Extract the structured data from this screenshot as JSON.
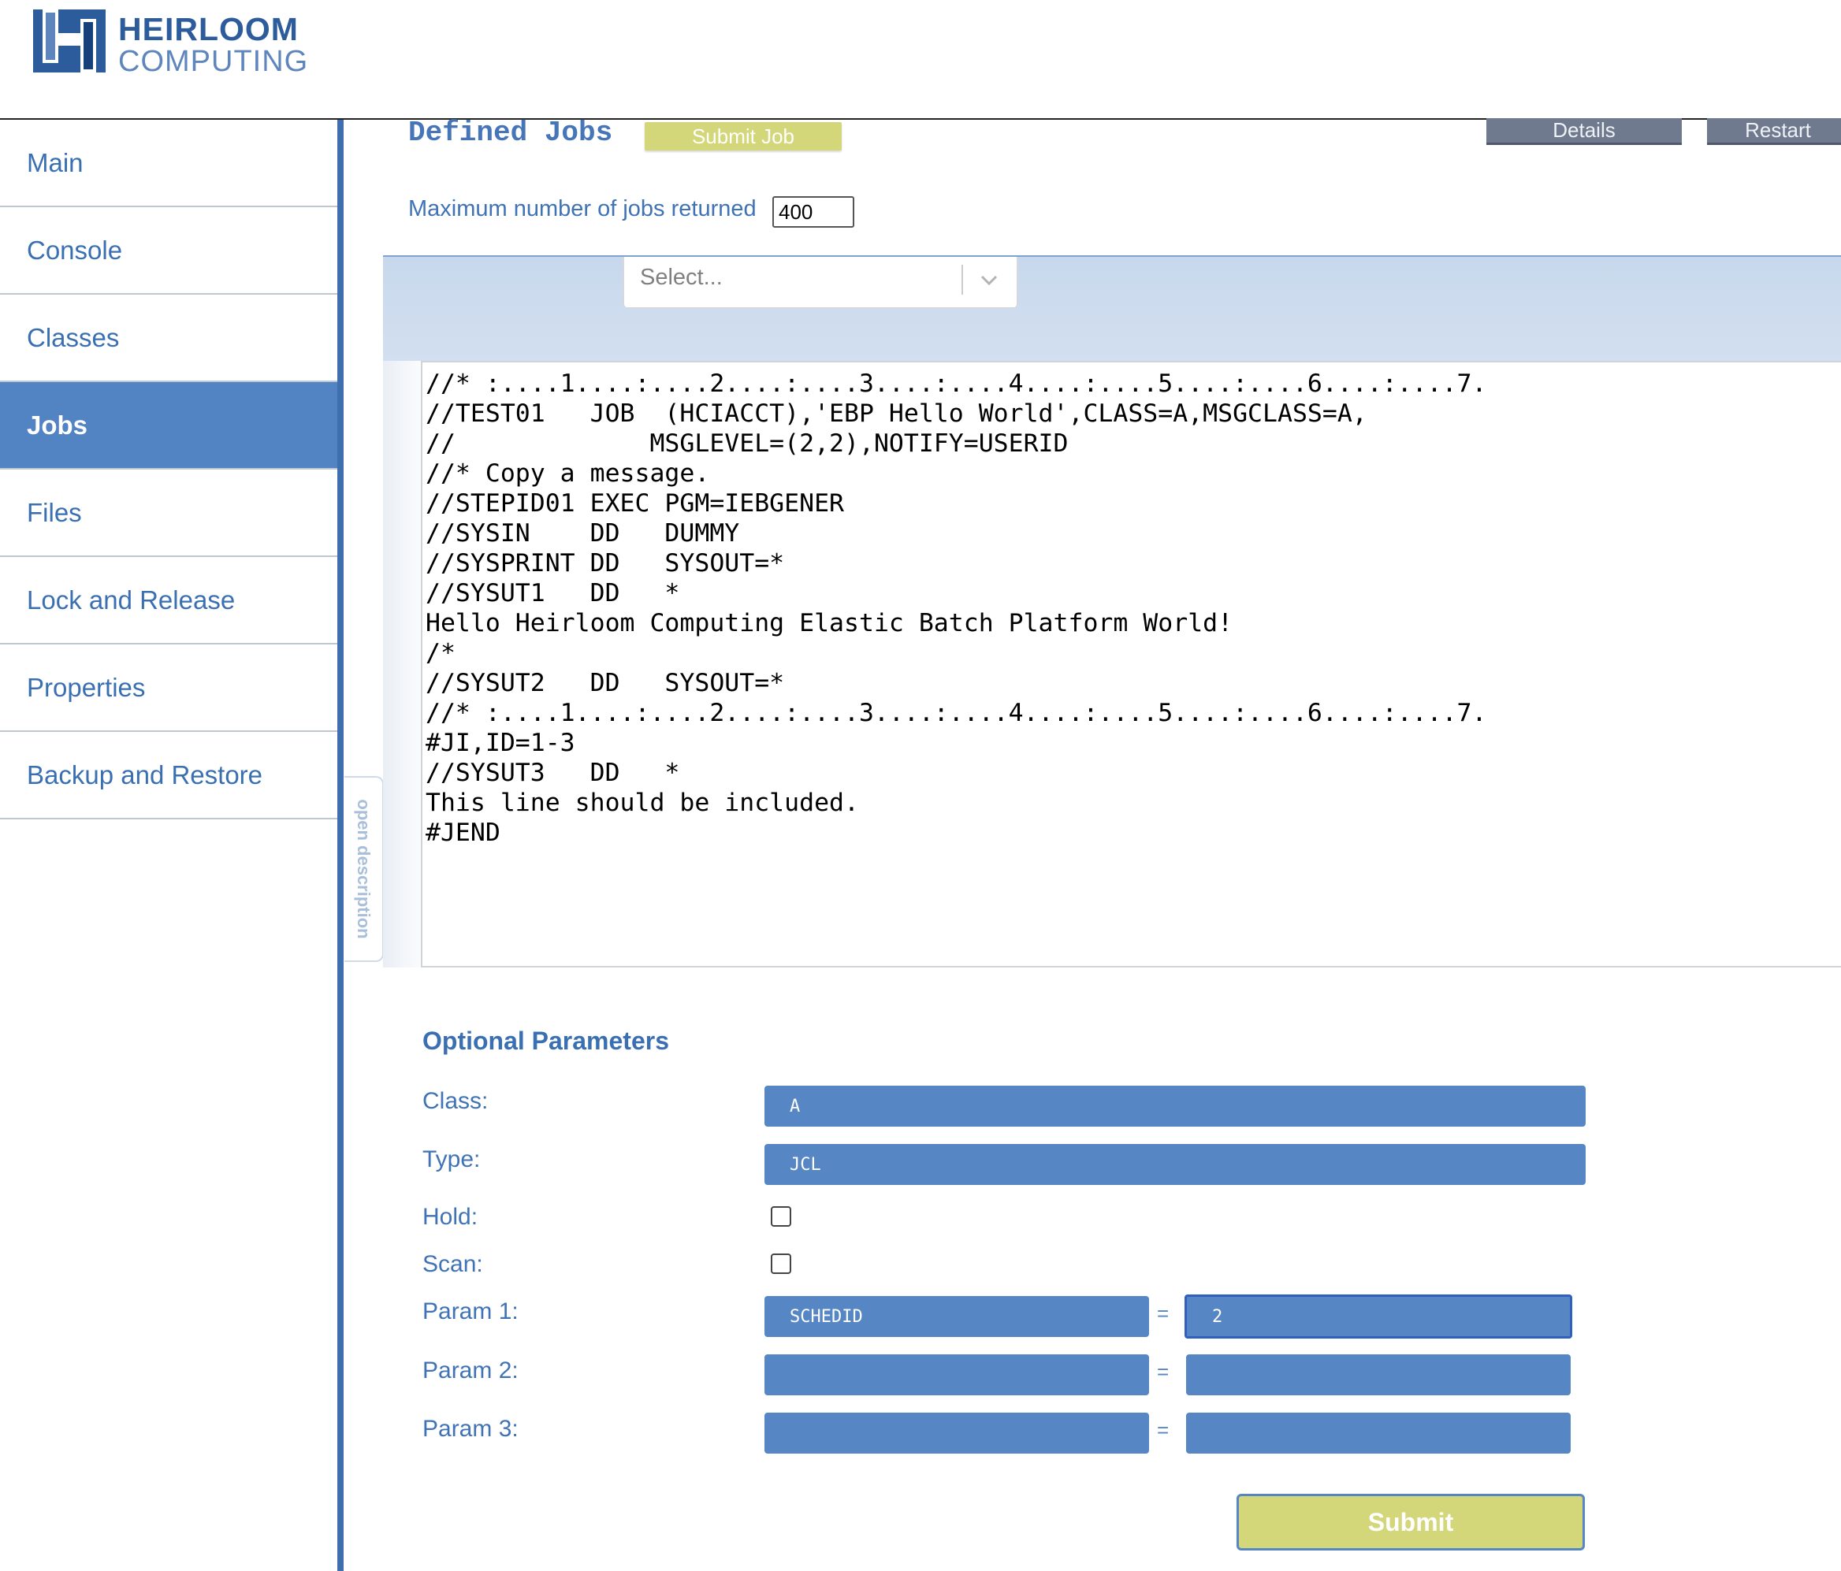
{
  "brand": {
    "line1": "HEIRLOOM",
    "line2": "COMPUTING",
    "colors": {
      "primary": "#2d5c9c",
      "secondary": "#5e86bd"
    }
  },
  "sidebar": {
    "items": [
      {
        "label": "Main"
      },
      {
        "label": "Console"
      },
      {
        "label": "Classes"
      },
      {
        "label": "Jobs",
        "active": true
      },
      {
        "label": "Files"
      },
      {
        "label": "Lock and Release"
      },
      {
        "label": "Properties"
      },
      {
        "label": "Backup and Restore"
      }
    ],
    "toggle_label": "open description"
  },
  "main": {
    "title": "Defined Jobs",
    "submit_job_label": "Submit Job",
    "details_label": "Details",
    "restart_label": "Restart",
    "max_jobs_label": "Maximum number of jobs returned",
    "max_jobs_value": "400",
    "select_placeholder": "Select...",
    "jcl_text": "//* :....1....:....2....:....3....:....4....:....5....:....6....:....7.\n//TEST01   JOB  (HCIACCT),'EBP Hello World',CLASS=A,MSGCLASS=A,\n//             MSGLEVEL=(2,2),NOTIFY=USERID\n//* Copy a message.\n//STEPID01 EXEC PGM=IEBGENER\n//SYSIN    DD   DUMMY\n//SYSPRINT DD   SYSOUT=*\n//SYSUT1   DD   *\nHello Heirloom Computing Elastic Batch Platform World!\n/*\n//SYSUT2   DD   SYSOUT=*\n//* :....1....:....2....:....3....:....4....:....5....:....6....:....7.\n#JI,ID=1-3\n//SYSUT3   DD   *\nThis line should be included.\n#JEND"
  },
  "optional": {
    "title": "Optional Parameters",
    "class_label": "Class:",
    "class_value": "A",
    "type_label": "Type:",
    "type_value": "JCL",
    "hold_label": "Hold:",
    "scan_label": "Scan:",
    "param1_label": "Param 1:",
    "param1_key": "SCHEDID",
    "param1_value": "2",
    "param2_label": "Param 2:",
    "param2_key": "",
    "param2_value": "",
    "param3_label": "Param 3:",
    "param3_key": "",
    "param3_value": "",
    "equals": "=",
    "submit_label": "Submit"
  },
  "colors": {
    "accent_blue": "#5686c4",
    "button_yellow": "#d4d67a",
    "button_gray": "#6f7a8f"
  }
}
